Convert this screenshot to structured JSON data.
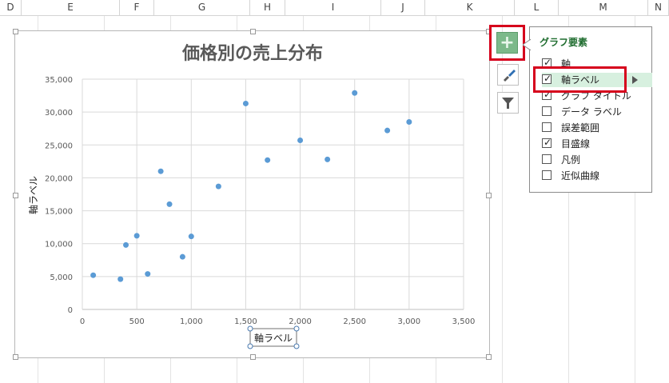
{
  "columns": [
    "D",
    "E",
    "F",
    "G",
    "H",
    "I",
    "J",
    "K",
    "L",
    "M",
    "N"
  ],
  "chart_data": {
    "type": "scatter",
    "title": "価格別の売上分布",
    "xlabel": "軸ラベル",
    "ylabel": "軸ラベル",
    "xlim": [
      0,
      3500
    ],
    "ylim": [
      0,
      35000
    ],
    "x_ticks": [
      "0",
      "500",
      "1,000",
      "1,500",
      "2,000",
      "2,500",
      "3,000",
      "3,500"
    ],
    "y_ticks": [
      "0",
      "5,000",
      "10,000",
      "15,000",
      "20,000",
      "25,000",
      "30,000",
      "35,000"
    ],
    "x_tick_values": [
      0,
      500,
      1000,
      1500,
      2000,
      2500,
      3000,
      3500
    ],
    "y_tick_values": [
      0,
      5000,
      10000,
      15000,
      20000,
      25000,
      30000,
      35000
    ],
    "grid": true,
    "point_color": "#5b9bd5",
    "points": [
      {
        "x": 100,
        "y": 5200
      },
      {
        "x": 350,
        "y": 4600
      },
      {
        "x": 400,
        "y": 9800
      },
      {
        "x": 500,
        "y": 11200
      },
      {
        "x": 600,
        "y": 5400
      },
      {
        "x": 720,
        "y": 21000
      },
      {
        "x": 800,
        "y": 16000
      },
      {
        "x": 920,
        "y": 8000
      },
      {
        "x": 1000,
        "y": 11100
      },
      {
        "x": 1250,
        "y": 18700
      },
      {
        "x": 1500,
        "y": 31300
      },
      {
        "x": 1700,
        "y": 22700
      },
      {
        "x": 2000,
        "y": 25700
      },
      {
        "x": 2250,
        "y": 22800
      },
      {
        "x": 2500,
        "y": 32900
      },
      {
        "x": 2800,
        "y": 27200
      },
      {
        "x": 3000,
        "y": 28500
      }
    ]
  },
  "side_buttons": {
    "chart_elements_icon": "plus-icon",
    "chart_styles_icon": "brush-icon",
    "chart_filters_icon": "funnel-icon"
  },
  "panel": {
    "title": "グラフ要素",
    "items": [
      {
        "label": "軸",
        "checked": true
      },
      {
        "label": "軸ラベル",
        "checked": true
      },
      {
        "label": "グラフ タイトル",
        "checked": true
      },
      {
        "label": "データ ラベル",
        "checked": false
      },
      {
        "label": "誤差範囲",
        "checked": false
      },
      {
        "label": "目盛線",
        "checked": true
      },
      {
        "label": "凡例",
        "checked": false
      },
      {
        "label": "近似曲線",
        "checked": false
      }
    ],
    "submenu_arrow_icon": "triangle-right-icon"
  },
  "colors": {
    "accent_green": "#70ad47",
    "highlight_red": "#d6001c",
    "item_highlight": "#d7f0df"
  }
}
